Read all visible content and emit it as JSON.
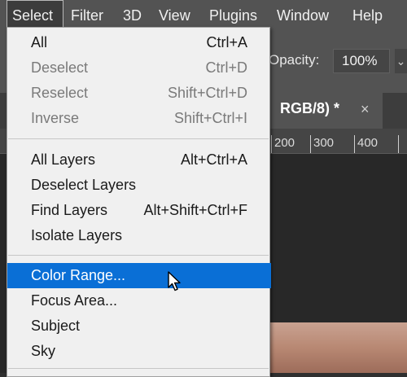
{
  "menubar": {
    "items": [
      {
        "label": "Select",
        "active": true
      },
      {
        "label": "Filter"
      },
      {
        "label": "3D"
      },
      {
        "label": "View"
      },
      {
        "label": "Plugins"
      },
      {
        "label": "Window"
      },
      {
        "label": "Help"
      }
    ]
  },
  "options": {
    "opacity_label": "Opacity:",
    "opacity_value": "100%"
  },
  "document_tab": {
    "title": "RGB/8) *",
    "close": "×"
  },
  "ruler": {
    "labels": [
      "200",
      "300",
      "400"
    ]
  },
  "menu": {
    "groups": [
      [
        {
          "label": "All",
          "shortcut": "Ctrl+A",
          "enabled": true
        },
        {
          "label": "Deselect",
          "shortcut": "Ctrl+D",
          "enabled": false
        },
        {
          "label": "Reselect",
          "shortcut": "Shift+Ctrl+D",
          "enabled": false
        },
        {
          "label": "Inverse",
          "shortcut": "Shift+Ctrl+I",
          "enabled": false
        }
      ],
      [
        {
          "label": "All Layers",
          "shortcut": "Alt+Ctrl+A",
          "enabled": true
        },
        {
          "label": "Deselect Layers",
          "shortcut": "",
          "enabled": true
        },
        {
          "label": "Find Layers",
          "shortcut": "Alt+Shift+Ctrl+F",
          "enabled": true
        },
        {
          "label": "Isolate Layers",
          "shortcut": "",
          "enabled": true
        }
      ],
      [
        {
          "label": "Color Range...",
          "shortcut": "",
          "enabled": true,
          "highlighted": true
        },
        {
          "label": "Focus Area...",
          "shortcut": "",
          "enabled": true
        },
        {
          "label": "Subject",
          "shortcut": "",
          "enabled": true
        },
        {
          "label": "Sky",
          "shortcut": "",
          "enabled": true
        }
      ]
    ],
    "highlight_color": "#0a6fd6"
  },
  "cursor": {
    "icon": "arrow-pointer-icon"
  }
}
